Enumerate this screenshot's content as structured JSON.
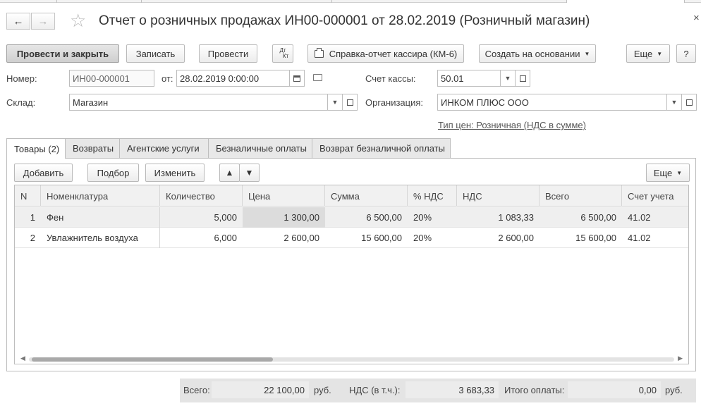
{
  "window": {
    "title": "Отчет о розничных продажах ИН00-000001 от 28.02.2019 (Розничный магазин)"
  },
  "nav": {
    "back_icon": "←",
    "forward_icon": "→",
    "star_icon": "☆",
    "close_icon": "×"
  },
  "toolbar": {
    "post_close": "Провести и закрыть",
    "save": "Записать",
    "post": "Провести",
    "dt_kt_top": "Дт",
    "dt_kt_bottom": "Кт",
    "km6": "Справка-отчет кассира (КМ-6)",
    "create_based": "Создать на основании",
    "more": "Еще",
    "help": "?"
  },
  "form": {
    "number_label": "Номер:",
    "number_value": "ИН00-000001",
    "date_label": "от:",
    "date_value": "28.02.2019  0:00:00",
    "warehouse_label": "Склад:",
    "warehouse_value": "Магазин",
    "cash_account_label": "Счет кассы:",
    "cash_account_value": "50.01",
    "org_label": "Организация:",
    "org_value": "ИНКОМ ПЛЮС ООО",
    "price_type_link": "Тип цен: Розничная (НДС в сумме)"
  },
  "tabs": [
    {
      "label": "Товары (2)",
      "active": true
    },
    {
      "label": "Возвраты"
    },
    {
      "label": "Агентские услуги"
    },
    {
      "label": "Безналичные оплаты"
    },
    {
      "label": "Возврат безналичной оплаты"
    }
  ],
  "grid_toolbar": {
    "add": "Добавить",
    "pick": "Подбор",
    "change": "Изменить",
    "more": "Еще"
  },
  "table": {
    "columns": [
      "N",
      "Номенклатура",
      "Количество",
      "Цена",
      "Сумма",
      "% НДС",
      "НДС",
      "Всего",
      "Счет учета"
    ],
    "rows": [
      [
        "1",
        "Фен",
        "5,000",
        "1 300,00",
        "6 500,00",
        "20%",
        "1 083,33",
        "6 500,00",
        "41.02"
      ],
      [
        "2",
        "Увлажнитель воздуха",
        "6,000",
        "2 600,00",
        "15 600,00",
        "20%",
        "2 600,00",
        "15 600,00",
        "41.02"
      ]
    ]
  },
  "totals": {
    "total_label": "Всего:",
    "total_value": "22 100,00",
    "currency": "руб.",
    "vat_label": "НДС (в т.ч.):",
    "vat_value": "3 683,33",
    "paid_label": "Итого оплаты:",
    "paid_value": "0,00",
    "currency2": "руб."
  }
}
